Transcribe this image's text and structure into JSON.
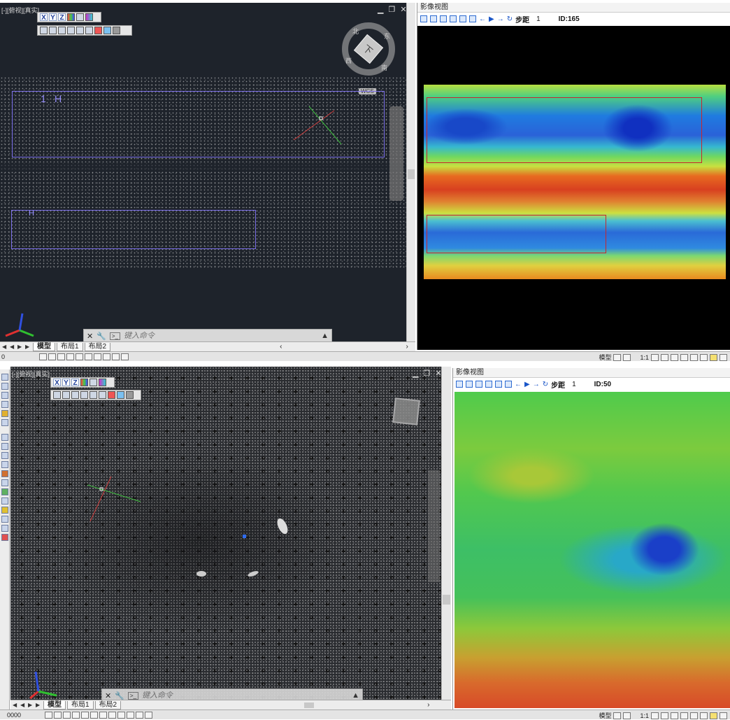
{
  "top": {
    "viewport": {
      "label": "[-][俯视][真实]",
      "win_controls": [
        "▁",
        "❐",
        "✕"
      ],
      "axis_buttons": [
        "X",
        "Y",
        "Z"
      ],
      "navcube": {
        "face": "下",
        "north": "北",
        "west": "西",
        "east": "东",
        "south": "南"
      },
      "wcs_label": "WCS",
      "box_labels": [
        "1",
        "H"
      ],
      "box2_label": "H"
    },
    "cmd": {
      "placeholder": "键入命令"
    },
    "tabs": [
      "模型",
      "布局1",
      "布局2"
    ],
    "image_view": {
      "title": "影像视图",
      "step_label": "步距",
      "step_value": "1",
      "id_label": "ID:165"
    }
  },
  "bottom": {
    "viewport": {
      "label": "[-][俯视][真实]",
      "win_controls": [
        "▁",
        "❐",
        "✕"
      ],
      "axis_buttons": [
        "X",
        "Y",
        "Z"
      ]
    },
    "cmd": {
      "placeholder": "键入命令"
    },
    "tabs": [
      "模型",
      "布局1",
      "布局2"
    ],
    "image_view": {
      "title": "影像视图",
      "step_label": "步距",
      "step_value": "1",
      "id_label": "ID:50"
    }
  },
  "status": {
    "coord_top": "0",
    "coord_bottom": "0000",
    "model_label": "模型",
    "scale_label": "1:1"
  },
  "colors": {
    "viewport_bg": "#1e232b",
    "selection_box": "#7a6ee8",
    "roi_box": "#c8262b"
  }
}
